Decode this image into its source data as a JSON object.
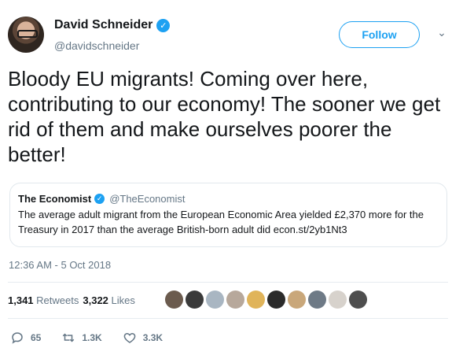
{
  "author": {
    "name": "David Schneider",
    "handle": "@davidschneider",
    "verified_mark": "✓"
  },
  "follow_label": "Follow",
  "caret": "⌄",
  "tweet_text": "Bloody EU migrants! Coming over here, contributing to our economy! The sooner we get rid of them and make ourselves poorer the better!",
  "quote": {
    "name": "The Economist",
    "handle": "@TheEconomist",
    "text": "The average adult migrant from the European Economic Area yielded £2,370 more for the Treasury in 2017 than the average British-born adult did econ.st/2yb1Nt3"
  },
  "timestamp": "12:36 AM - 5 Oct 2018",
  "stats": {
    "retweets_count": "1,341",
    "retweets_label": "Retweets",
    "likes_count": "3,322",
    "likes_label": "Likes"
  },
  "liker_colors": [
    "#6b5b4e",
    "#3a3a3a",
    "#a9b6c2",
    "#b7a89b",
    "#e0b45a",
    "#2b2b2b",
    "#c9a77a",
    "#6e7a86",
    "#d7d2cc",
    "#4e4e4e"
  ],
  "actions": {
    "replies": "65",
    "retweets": "1.3K",
    "likes": "3.3K"
  },
  "colors": {
    "accent": "#1da1f2",
    "secondary_text": "#657786"
  }
}
